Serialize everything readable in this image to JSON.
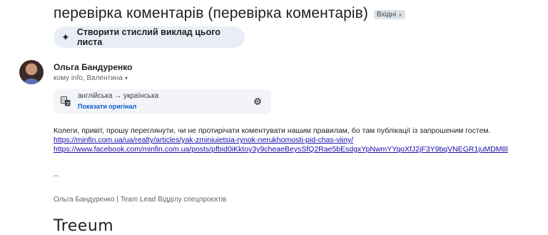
{
  "subject": {
    "title": "перевірка коментарів (перевірка коментарів)",
    "label": "Вхідні",
    "label_remove": "×"
  },
  "summarize": {
    "icon": "sparkle-icon",
    "label": "Створити стислий виклад цього листа"
  },
  "sender": {
    "name": "Ольга Бандуренко",
    "recipients": "кому info, Валентина",
    "caret": "▾"
  },
  "translation": {
    "languages": "англійська → українська",
    "show_original": "Показати оригінал"
  },
  "body": {
    "text": "Колеги, привіт, прошу переглянути, чи не протирічати коментувати нашим правилам, бо там публікації із запрошеним гостем.",
    "link1": "https://minfin.com.ua/ua/realty/articles/yak-zminiuietsia-rynok-nerukhomosti-pid-chas-viiny/",
    "link2": "https://www.facebook.com/minfin.com.ua/posts/pfbid0iKktoy3y9cheaeBeysSfQ2Rae5bEsdgxYpNwmYYqoXfJ2jF3Y9bqVNEGR1juMDM8l"
  },
  "signature": {
    "dash": "--",
    "line": "Ольга Бандуренко | Team Lead Відділу спецпроєктів",
    "logo_text": "Treeum"
  },
  "colors": {
    "summarize_bg": "#e9eef6",
    "link": "#1a0dab",
    "accent_blue": "#0b57d0"
  }
}
